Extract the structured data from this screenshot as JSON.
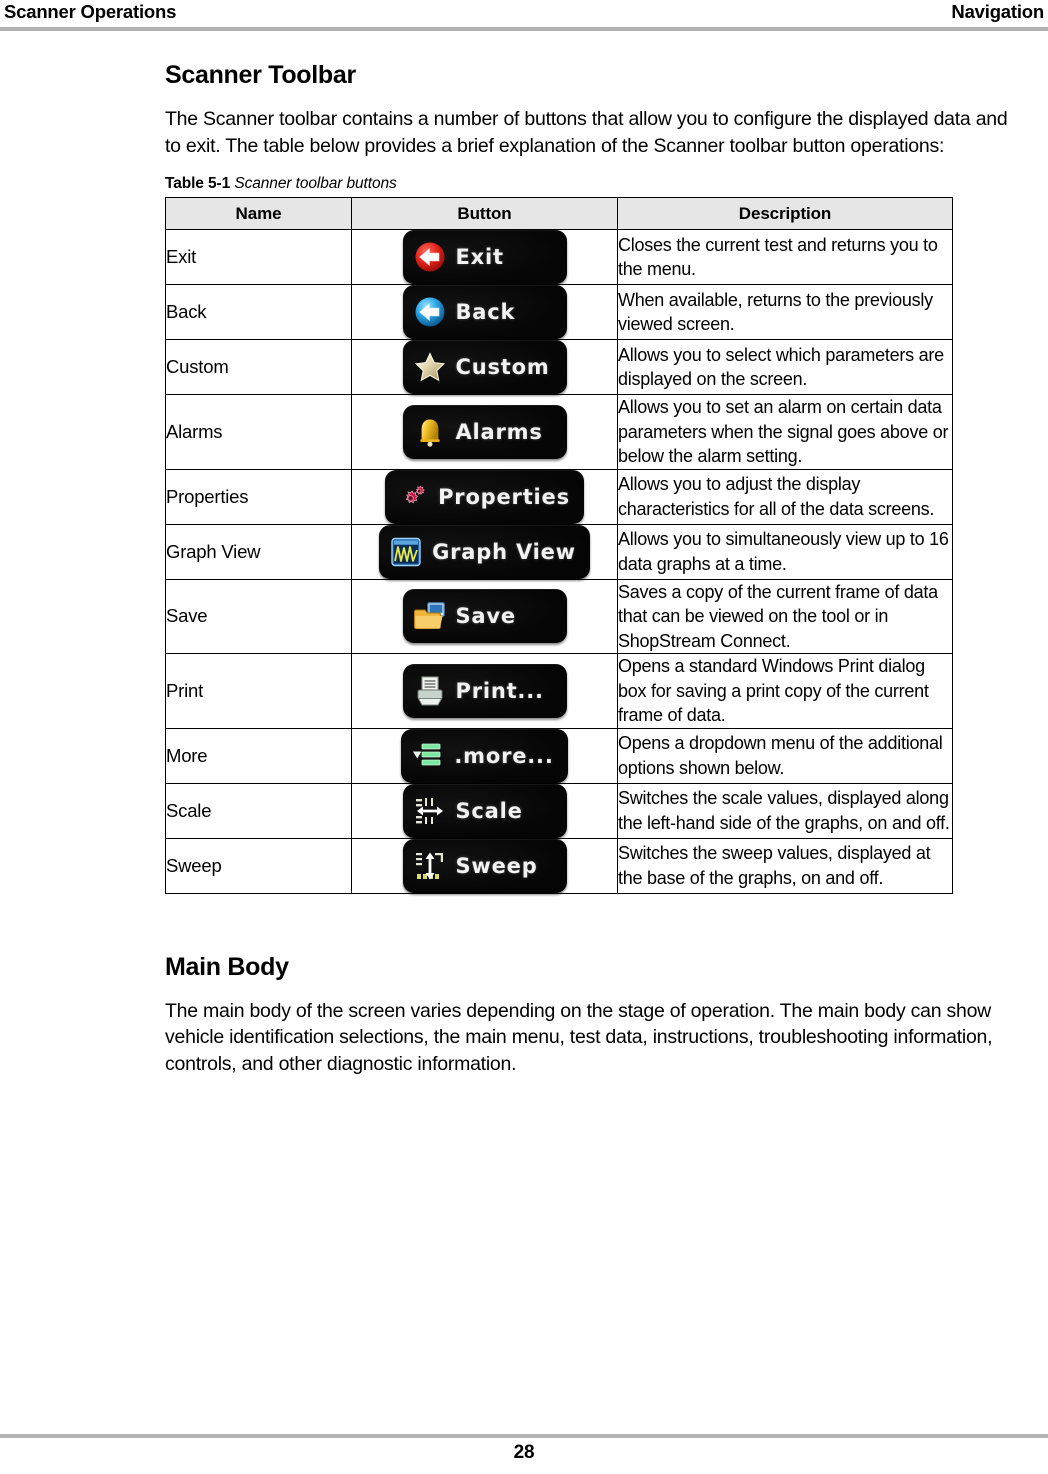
{
  "header": {
    "left": "Scanner Operations",
    "right": "Navigation"
  },
  "section": {
    "title": "Scanner Toolbar",
    "intro": "The Scanner toolbar contains a number of buttons that allow you to configure the displayed data and to exit. The table below provides a brief explanation of the Scanner toolbar button operations:"
  },
  "table": {
    "caption_label": "Table 5-1",
    "caption_title": "Scanner toolbar buttons",
    "columns": [
      "Name",
      "Button",
      "Description"
    ],
    "rows": [
      {
        "name": "Exit",
        "button_label": "Exit",
        "icon": "red-circle-left-arrow-icon",
        "description": "Closes the current test and returns you to the menu."
      },
      {
        "name": "Back",
        "button_label": "Back",
        "icon": "blue-circle-left-arrow-icon",
        "description": "When available, returns to the previously viewed screen."
      },
      {
        "name": "Custom",
        "button_label": "Custom",
        "icon": "star-icon",
        "description": "Allows you to select which parameters are displayed on the screen."
      },
      {
        "name": "Alarms",
        "button_label": "Alarms",
        "icon": "bell-icon",
        "description": "Allows you to set an alarm on certain data parameters when the signal goes above or below the alarm setting."
      },
      {
        "name": "Properties",
        "button_label": "Properties",
        "icon": "gears-icon",
        "description": "Allows you to adjust the display characteristics for all of the data screens."
      },
      {
        "name": "Graph View",
        "button_label": "Graph View",
        "icon": "waveform-window-icon",
        "description": "Allows you to simultaneously view up to 16 data graphs at a time."
      },
      {
        "name": "Save",
        "button_label": "Save",
        "icon": "folder-screen-icon",
        "description": "Saves a copy of the current frame of data that can be viewed on the tool or in ShopStream Connect."
      },
      {
        "name": "Print",
        "button_label": "Print...",
        "icon": "printer-icon",
        "description": "Opens a standard Windows Print dialog box for saving a print copy of the current frame of data."
      },
      {
        "name": "More",
        "button_label": ".more...",
        "icon": "dropdown-bars-icon",
        "description": "Opens a dropdown menu of the additional options shown below."
      },
      {
        "name": "Scale",
        "button_label": "Scale",
        "icon": "horizontal-scale-arrow-icon",
        "description": "Switches the scale values, displayed along the left-hand side of the graphs, on and off."
      },
      {
        "name": "Sweep",
        "button_label": "Sweep",
        "icon": "vertical-sweep-arrow-icon",
        "description": "Switches the sweep values, displayed at the base of the graphs, on and off."
      }
    ]
  },
  "section2": {
    "title": "Main Body",
    "body": "The main body of the screen varies depending on the stage of operation. The main body can show vehicle identification selections, the main menu, test data, instructions, troubleshooting information, controls, and other diagnostic information."
  },
  "footer": {
    "page_number": "28"
  },
  "colors": {
    "exit_accent": "#d81f1f",
    "back_accent": "#2aa6e8",
    "star_accent": "#ece0b4",
    "bell_accent": "#f5c02a",
    "gears_accent": "#c8173e",
    "graph_accent": "#e8e84a",
    "save_accent": "#f0b63c",
    "more_accent": "#7de8a0",
    "button_face": "#060606",
    "rule": "#b3b3b3",
    "table_header_fill": "#e6e6e6"
  }
}
